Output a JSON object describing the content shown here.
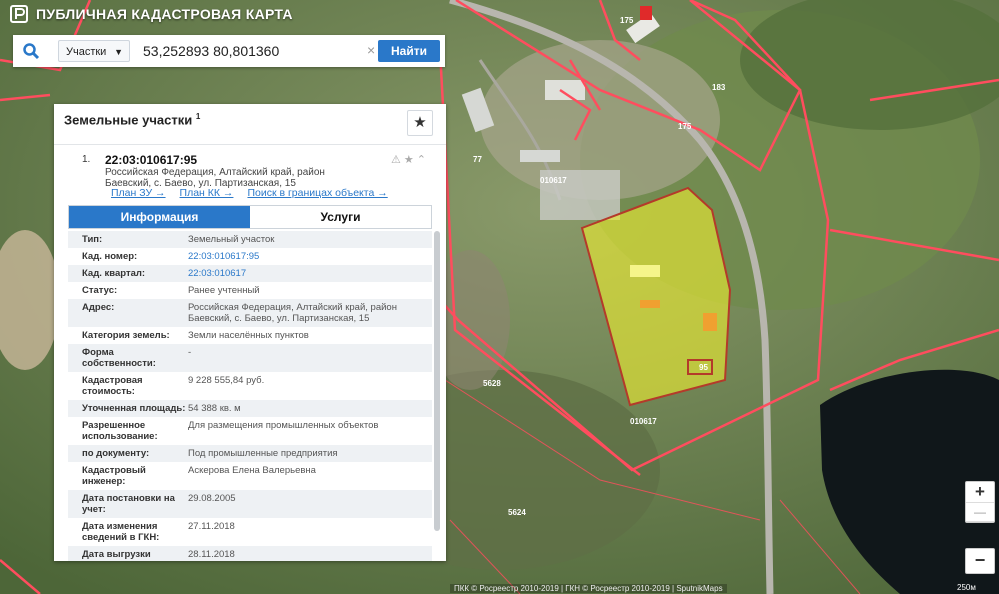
{
  "app": {
    "title": "ПУБЛИЧНАЯ КАДАСТРОВАЯ КАРТА"
  },
  "search": {
    "category": "Участки",
    "query": "53,252893 80,801360",
    "find_label": "Найти"
  },
  "card": {
    "title": "Земельные участки",
    "title_sup": "1",
    "item": {
      "number": "1.",
      "cad_number": "22:03:010617:95",
      "address": "Российская Федерация, Алтайский край, район Баевский, с. Баево, ул. Партизанская, 15"
    },
    "links": [
      "План ЗУ →",
      "План КК →",
      "Поиск в границах объекта →"
    ],
    "tabs": {
      "info": "Информация",
      "services": "Услуги"
    },
    "rows": [
      {
        "k": "Тип:",
        "v": "Земельный участок"
      },
      {
        "k": "Кад. номер:",
        "v": "22:03:010617:95"
      },
      {
        "k": "Кад. квартал:",
        "v": "22:03:010617"
      },
      {
        "k": "Статус:",
        "v": "Ранее учтенный"
      },
      {
        "k": "Адрес:",
        "v": "Российская Федерация, Алтайский край, район Баевский, с. Баево, ул. Партизанская, 15"
      },
      {
        "k": "Категория земель:",
        "v": "Земли населённых пунктов"
      },
      {
        "k": "Форма собственности:",
        "v": "-"
      },
      {
        "k": "Кадастровая стоимость:",
        "v": "9 228 555,84 руб."
      },
      {
        "k": "Уточненная площадь:",
        "v": "54 388 кв. м"
      },
      {
        "k": "Разрешенное использование:",
        "v": "Для размещения промышленных объектов"
      },
      {
        "k": "по документу:",
        "v": "Под промышленные предприятия"
      },
      {
        "k": "Кадастровый инженер:",
        "v": "Аскерова Елена Валерьевна"
      },
      {
        "k": "Дата постановки на учет:",
        "v": "29.08.2005"
      },
      {
        "k": "Дата изменения сведений в ГКН:",
        "v": "27.11.2018"
      },
      {
        "k": "Дата выгрузки сведений из ГКН:",
        "v": "28.11.2018"
      }
    ]
  },
  "map": {
    "labels": {
      "l1": "175",
      "l2": "183",
      "l3": "175",
      "l4": "77",
      "l5": "010617",
      "l6": "95",
      "l7": "5628",
      "l8": "010617",
      "l9": "5624"
    },
    "colors": {
      "boundary": "#ff4d5e",
      "parcel_fill": "#e6e834",
      "water": "#10171a",
      "road": "#b8b6ae"
    }
  },
  "zoom": {
    "in": "+",
    "out": "−"
  },
  "copyright": "ПКК © Росреестр 2010-2019 | ГКН © Росреестр 2010-2019 | SputnikMaps",
  "scale": "250м"
}
